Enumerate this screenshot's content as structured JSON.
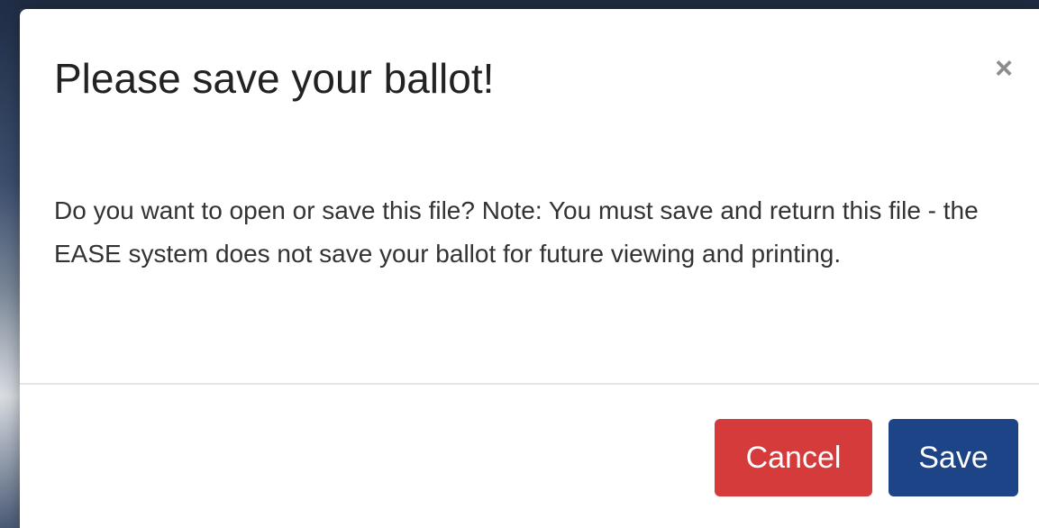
{
  "modal": {
    "title": "Please save your ballot!",
    "close_label": "×",
    "body": "Do you want to open or save this file? Note: You must save and return this file - the EASE system does not save your ballot for future viewing and printing.",
    "cancel_label": "Cancel",
    "save_label": "Save"
  },
  "colors": {
    "cancel_button": "#d63b3b",
    "save_button": "#1d4487",
    "backdrop": "#2c3e5a"
  },
  "icons": {
    "close": "close-icon"
  }
}
